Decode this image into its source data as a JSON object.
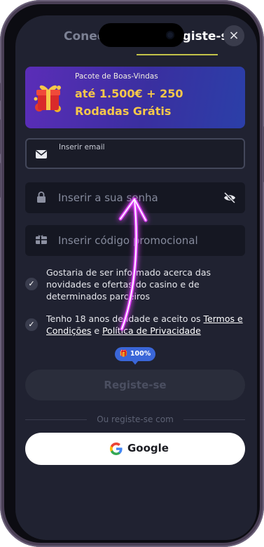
{
  "tabs": {
    "login_label": "Conect",
    "register_label": "Registe-se"
  },
  "close_icon": "×",
  "banner": {
    "subtitle": "Pacote de Boas-Vindas",
    "line1": "até 1.500€ + 250",
    "line2": "Rodadas Grátis"
  },
  "email_field": {
    "label": "Inserir email",
    "icon": "envelope-icon"
  },
  "password_field": {
    "placeholder": "Inserir a sua senha",
    "icon": "lock-icon",
    "toggle_icon": "eye-off-icon"
  },
  "promo_field": {
    "placeholder": "Inserir código promocional",
    "icon": "gift-icon"
  },
  "consents": {
    "marketing": "Gostaria de ser informado acerca das novidades e ofertas do casino e de determinados parceiros",
    "terms_prefix": "Tenho 18 anos de idade e aceito os ",
    "terms_link": "Termos e Condições",
    "terms_joiner": " e ",
    "privacy_link": "Política de Privacidade"
  },
  "progress_badge": "100%",
  "register_button": "Registe-se",
  "divider_text": "Ou registe-se com",
  "google_button": "Google",
  "colors": {
    "background": "#202231",
    "accent_underline": "#c2c24a",
    "banner_gold": "#f6c84a",
    "gesture": "#e040fb"
  }
}
